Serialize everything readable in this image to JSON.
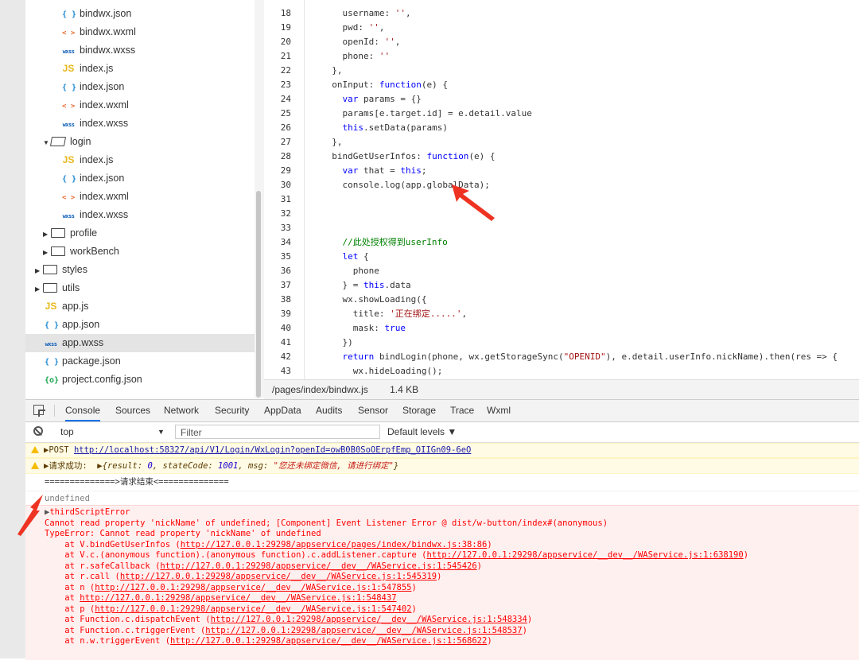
{
  "file_tree": {
    "items": [
      {
        "type": "json",
        "label": "bindwx.json",
        "indent": 46
      },
      {
        "type": "wxml",
        "label": "bindwx.wxml",
        "indent": 46
      },
      {
        "type": "wxss",
        "label": "bindwx.wxss",
        "indent": 46
      },
      {
        "type": "js",
        "label": "index.js",
        "indent": 46
      },
      {
        "type": "json",
        "label": "index.json",
        "indent": 46
      },
      {
        "type": "wxml",
        "label": "index.wxml",
        "indent": 46
      },
      {
        "type": "wxss",
        "label": "index.wxss",
        "indent": 46
      },
      {
        "type": "folder-open",
        "label": "login",
        "indent": 22,
        "arrow": "▼"
      },
      {
        "type": "js",
        "label": "index.js",
        "indent": 46
      },
      {
        "type": "json",
        "label": "index.json",
        "indent": 46
      },
      {
        "type": "wxml",
        "label": "index.wxml",
        "indent": 46
      },
      {
        "type": "wxss",
        "label": "index.wxss",
        "indent": 46
      },
      {
        "type": "folder",
        "label": "profile",
        "indent": 22,
        "arrow": "▶"
      },
      {
        "type": "folder",
        "label": "workBench",
        "indent": 22,
        "arrow": "▶"
      },
      {
        "type": "folder",
        "label": "styles",
        "indent": 12,
        "arrow": "▶"
      },
      {
        "type": "folder",
        "label": "utils",
        "indent": 12,
        "arrow": "▶"
      },
      {
        "type": "js",
        "label": "app.js",
        "indent": 24
      },
      {
        "type": "json",
        "label": "app.json",
        "indent": 24
      },
      {
        "type": "wxss",
        "label": "app.wxss",
        "indent": 24,
        "selected": true
      },
      {
        "type": "json",
        "label": "package.json",
        "indent": 24
      },
      {
        "type": "cfg",
        "label": "project.config.json",
        "indent": 24
      }
    ]
  },
  "editor": {
    "lines": [
      {
        "n": "18",
        "html": "    username: <span class='str'>''</span>,"
      },
      {
        "n": "19",
        "html": "    pwd: <span class='str'>''</span>,"
      },
      {
        "n": "20",
        "html": "    openId: <span class='str'>''</span>,"
      },
      {
        "n": "21",
        "html": "    phone: <span class='str'>''</span>"
      },
      {
        "n": "22",
        "html": "  },"
      },
      {
        "n": "23",
        "html": "  onInput: <span class='kw'>function</span>(e) {"
      },
      {
        "n": "24",
        "html": "    <span class='kw'>var</span> params = {}"
      },
      {
        "n": "25",
        "html": "    params[e.target.id] = e.detail.value"
      },
      {
        "n": "26",
        "html": "    <span class='kw'>this</span>.setData(params)"
      },
      {
        "n": "27",
        "html": "  },"
      },
      {
        "n": "28",
        "html": "  bindGetUserInfos: <span class='kw'>function</span>(e) {"
      },
      {
        "n": "29",
        "html": "    <span class='kw'>var</span> that = <span class='kw'>this</span>;"
      },
      {
        "n": "30",
        "html": "    console.log(app.globalData);"
      },
      {
        "n": "31",
        "html": ""
      },
      {
        "n": "32",
        "html": ""
      },
      {
        "n": "33",
        "html": ""
      },
      {
        "n": "34",
        "html": "    <span class='cm'>//此处授权得到userInfo</span>"
      },
      {
        "n": "35",
        "html": "    <span class='kw'>let</span> {"
      },
      {
        "n": "36",
        "html": "      phone"
      },
      {
        "n": "37",
        "html": "    } = <span class='kw'>this</span>.data"
      },
      {
        "n": "38",
        "html": "    wx.showLoading({"
      },
      {
        "n": "39",
        "html": "      title: <span class='str'>'正在绑定.....'</span>,"
      },
      {
        "n": "40",
        "html": "      mask: <span class='kw'>true</span>"
      },
      {
        "n": "41",
        "html": "    })"
      },
      {
        "n": "42",
        "html": "    <span class='kw'>return</span> bindLogin(phone, wx.getStorageSync(<span class='str'>\"OPENID\"</span>), e.detail.userInfo.nickName).then(res => {"
      },
      {
        "n": "43",
        "html": "      wx.hideLoading();"
      }
    ]
  },
  "status": {
    "path": "/pages/index/bindwx.js",
    "size": "1.4 KB"
  },
  "devtools": {
    "tabs": [
      "Console",
      "Sources",
      "Network",
      "Security",
      "AppData",
      "Audits",
      "Sensor",
      "Storage",
      "Trace",
      "Wxml"
    ],
    "context": "top",
    "filter_placeholder": "Filter",
    "levels": "Default levels ▼"
  },
  "console": {
    "post_url": "http://localhost:58327/api/V1/Login/WxLogin?openId=owB0B0SoOErpfEmp_OIIGn09-6eO",
    "success_label": "请求成功:",
    "success_obj_prefix": "{result: ",
    "success_result": "0",
    "success_mid": ", stateCode: ",
    "success_code": "1001",
    "success_msg_label": ", msg: ",
    "success_msg": "\"您还未绑定微信, 请进行绑定\"",
    "success_end": "}",
    "end_line": "==============>请求结束<==============",
    "undefined_text": "undefined",
    "error_title": "thirdScriptError",
    "error_lines": [
      "Cannot read property 'nickName' of undefined; [Component] Event Listener Error @ dist/w-button/index#(anonymous)",
      "TypeError: Cannot read property 'nickName' of undefined"
    ],
    "stack": [
      {
        "pre": "    at V.bindGetUserInfos (",
        "link": "http://127.0.0.1:29298/appservice/pages/index/bindwx.js:38:86",
        "post": ")"
      },
      {
        "pre": "    at V.c.(anonymous function).(anonymous function).c.addListener.capture (",
        "link": "http://127.0.0.1:29298/appservice/__dev__/WAService.js:1:638190",
        "post": ")"
      },
      {
        "pre": "    at r.safeCallback (",
        "link": "http://127.0.0.1:29298/appservice/__dev__/WAService.js:1:545426",
        "post": ")"
      },
      {
        "pre": "    at r.call (",
        "link": "http://127.0.0.1:29298/appservice/__dev__/WAService.js:1:545319",
        "post": ")"
      },
      {
        "pre": "    at n (",
        "link": "http://127.0.0.1:29298/appservice/__dev__/WAService.js:1:547855",
        "post": ")"
      },
      {
        "pre": "    at ",
        "link": "http://127.0.0.1:29298/appservice/__dev__/WAService.js:1:548437",
        "post": ""
      },
      {
        "pre": "    at p (",
        "link": "http://127.0.0.1:29298/appservice/__dev__/WAService.js:1:547402",
        "post": ")"
      },
      {
        "pre": "    at Function.c.dispatchEvent (",
        "link": "http://127.0.0.1:29298/appservice/__dev__/WAService.js:1:548334",
        "post": ")"
      },
      {
        "pre": "    at Function.c.triggerEvent (",
        "link": "http://127.0.0.1:29298/appservice/__dev__/WAService.js:1:548537",
        "post": ")"
      },
      {
        "pre": "    at n.w.triggerEvent (",
        "link": "http://127.0.0.1:29298/appservice/__dev__/WAService.js:1:568622",
        "post": ")"
      }
    ]
  }
}
